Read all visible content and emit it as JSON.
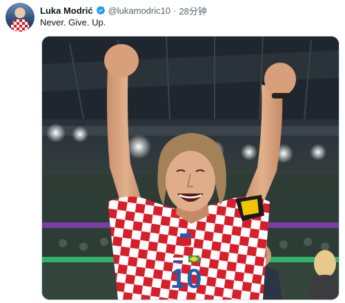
{
  "author": {
    "name": "Luka Modrić",
    "handle": "@lukamodric10",
    "separator": "·",
    "timestamp": "28分钟",
    "verified": true,
    "verified_color": "#1d9bf0"
  },
  "tweet": {
    "text": "Never. Give. Up."
  },
  "media": {
    "jersey_number": "10",
    "colors": {
      "checker_red": "#d81e2b",
      "checker_white": "#ffffff",
      "number_blue": "#1d5fb0"
    }
  }
}
